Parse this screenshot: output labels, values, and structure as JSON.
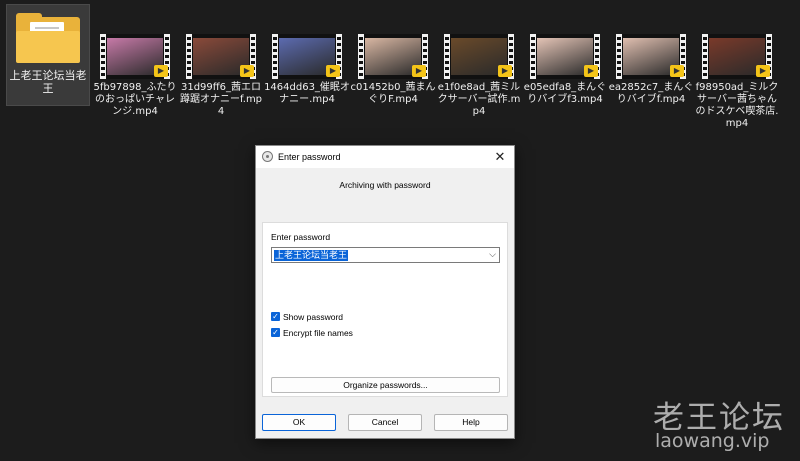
{
  "desktop": {
    "folder": {
      "label": "上老王论坛当老王",
      "icon": "folder-icon"
    },
    "files": [
      {
        "name": "5fb97898_ふたりのおっぱいチャレンジ.mp4",
        "thumb_color": "#c77aa8"
      },
      {
        "name": "31d99ff6_茜エロ蹲踞オナニーf.mp4",
        "thumb_color": "#8a4a3a"
      },
      {
        "name": "1464dd63_催眠オナニー.mp4",
        "thumb_color": "#5c6bb0"
      },
      {
        "name": "c01452b0_茜まんぐりF.mp4",
        "thumb_color": "#d9b7a3"
      },
      {
        "name": "e1f0e8ad_茜ミルクサーバー試作.mp4",
        "thumb_color": "#6a4a2a"
      },
      {
        "name": "e05edfa8_まんぐりバイブf3.mp4",
        "thumb_color": "#e4c4b6"
      },
      {
        "name": "ea2852c7_まんぐりバイブf.mp4",
        "thumb_color": "#e0bfb0"
      },
      {
        "name": "f98950ad_ミルクサーバー茜ちゃんのドスケベ喫茶店.mp4",
        "thumb_color": "#7a3a2a"
      }
    ],
    "badge_glyph": "▶"
  },
  "dialog": {
    "title": "Enter password",
    "close_glyph": "✕",
    "heading": "Archiving with password",
    "password_label": "Enter password",
    "password_value": "上老王论坛当老王",
    "dropdown_glyph": "⌵",
    "show_password_label": "Show password",
    "show_password_checked": true,
    "encrypt_names_label": "Encrypt file names",
    "encrypt_names_checked": true,
    "check_glyph": "✓",
    "organize_label": "Organize passwords...",
    "ok_label": "OK",
    "cancel_label": "Cancel",
    "help_label": "Help"
  },
  "watermark": {
    "title": "老王论坛",
    "url": "laowang.vip"
  }
}
